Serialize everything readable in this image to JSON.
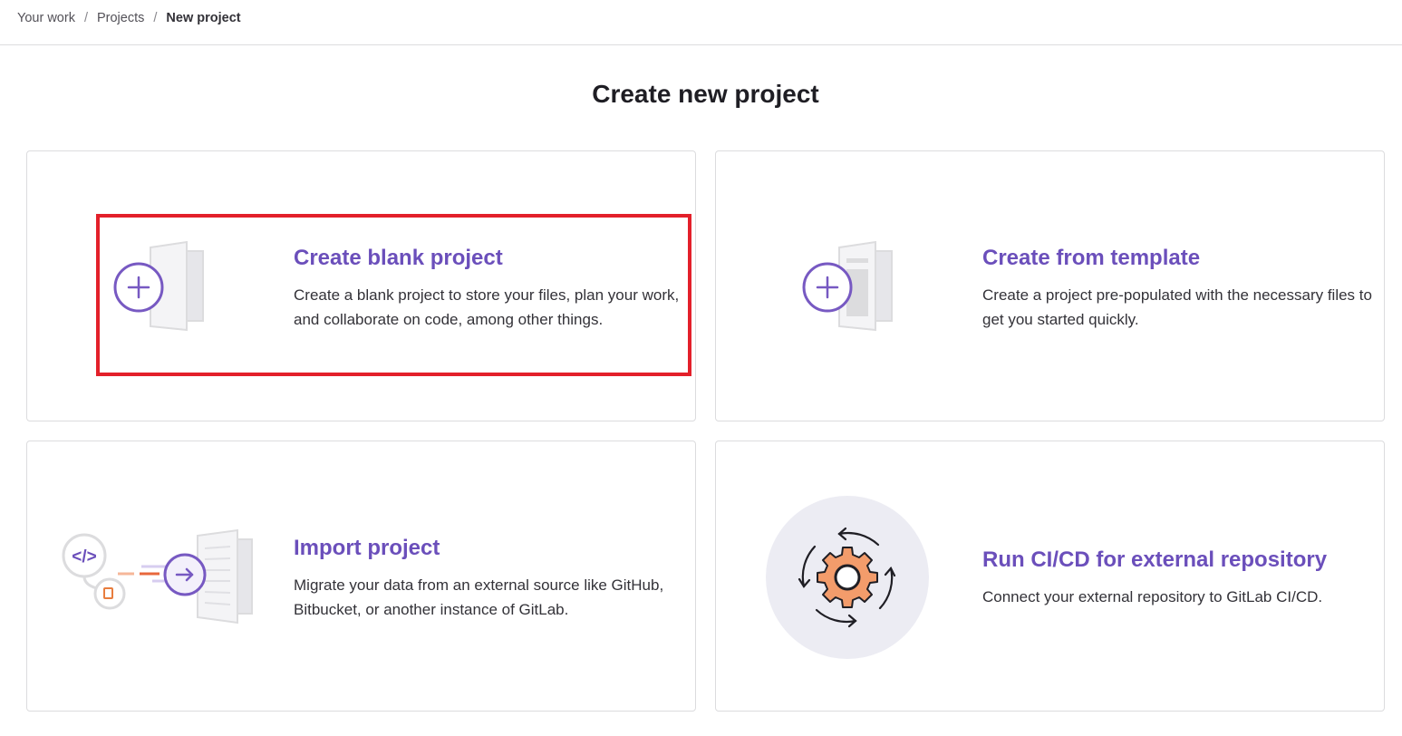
{
  "breadcrumb": {
    "items": [
      "Your work",
      "Projects"
    ],
    "current": "New project",
    "separator": "/"
  },
  "page": {
    "title": "Create new project"
  },
  "cards": [
    {
      "title": "Create blank project",
      "description": "Create a blank project to store your files, plan your work, and collaborate on code, among other things.",
      "icon": "blank-project-icon"
    },
    {
      "title": "Create from template",
      "description": "Create a project pre-populated with the necessary files to get you started quickly.",
      "icon": "template-project-icon"
    },
    {
      "title": "Import project",
      "description": "Migrate your data from an external source like GitHub, Bitbucket, or another instance of GitLab.",
      "icon": "import-project-icon"
    },
    {
      "title": "Run CI/CD for external repository",
      "description": "Connect your external repository to GitLab CI/CD.",
      "icon": "cicd-gear-icon"
    }
  ],
  "colors": {
    "accent": "#6b4fbb",
    "highlight": "#e3202a",
    "gear": "#f39c6b",
    "gear_bg": "#ececf3"
  }
}
